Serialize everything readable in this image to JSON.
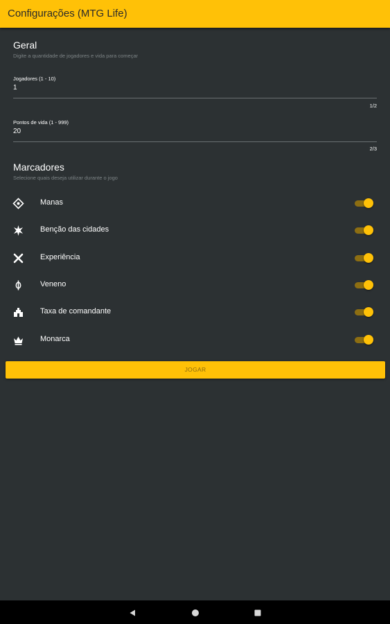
{
  "appbar": {
    "title": "Configurações (MTG Life)"
  },
  "general": {
    "title": "Geral",
    "subtitle": "Digite a quantidade de jogadores e vida para começar",
    "players": {
      "label": "Jogadores (1 - 10)",
      "value": "1",
      "counter": "1/2"
    },
    "life": {
      "label": "Pontos de vida (1 - 999)",
      "value": "20",
      "counter": "2/3"
    }
  },
  "markers": {
    "title": "Marcadores",
    "subtitle": "Selecione quais deseja utilizar durante o jogo",
    "items": [
      {
        "label": "Manas",
        "icon": "mana-icon",
        "enabled": true
      },
      {
        "label": "Benção das cidades",
        "icon": "city-blessing-icon",
        "enabled": true
      },
      {
        "label": "Experiência",
        "icon": "experience-icon",
        "enabled": true
      },
      {
        "label": "Veneno",
        "icon": "poison-icon",
        "enabled": true
      },
      {
        "label": "Taxa de comandante",
        "icon": "commander-tax-icon",
        "enabled": true
      },
      {
        "label": "Monarca",
        "icon": "monarch-icon",
        "enabled": true
      }
    ]
  },
  "play_button": {
    "label": "JOGAR"
  },
  "navigation": {
    "back": "back-icon",
    "home": "home-icon",
    "recents": "recents-icon"
  },
  "colors": {
    "accent": "#ffc107",
    "background": "#2c3133",
    "secondary_text": "#7c8385"
  }
}
